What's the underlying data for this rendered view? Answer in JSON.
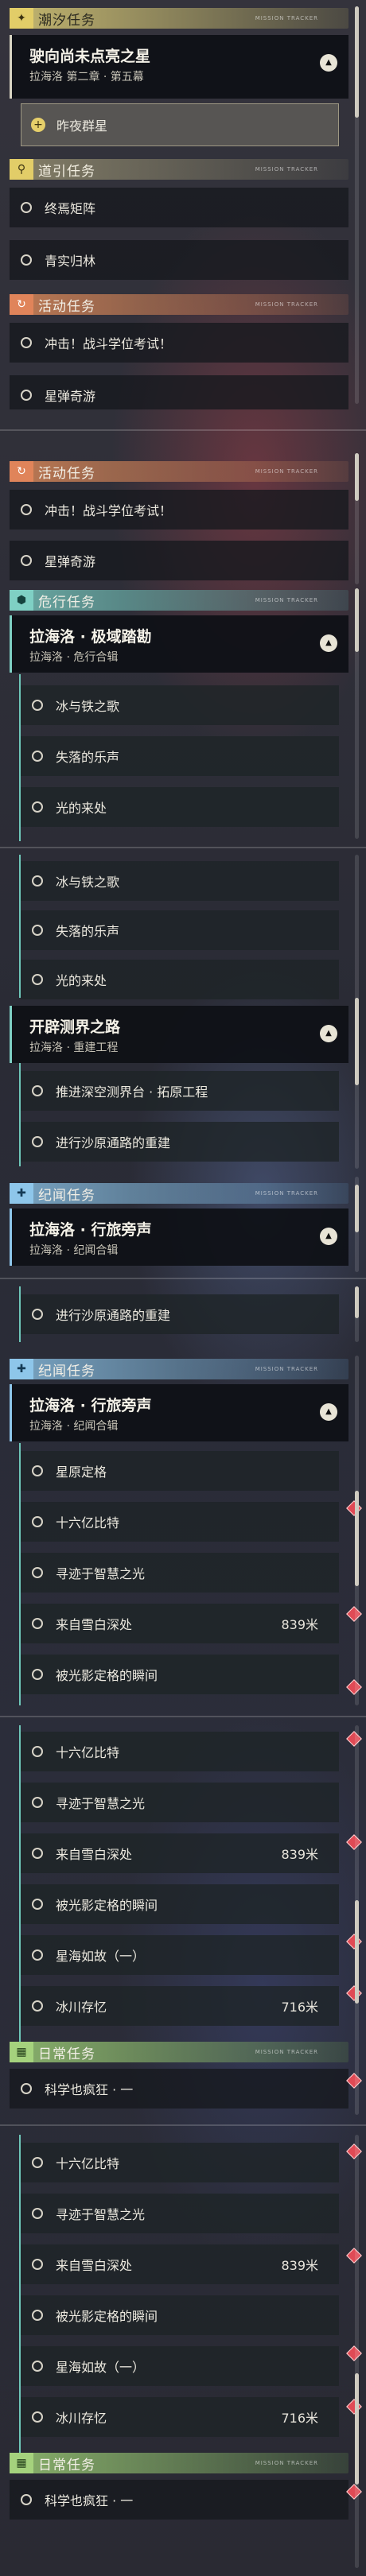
{
  "headers": {
    "chaoxi": "潮汐任务",
    "daoyin": "道引任务",
    "huodong": "活动任务",
    "weixing": "危行任务",
    "jiwen": "纪闻任务",
    "richang": "日常任务"
  },
  "header_tag": "MISSION TRACKER",
  "cards": {
    "lunar": {
      "title": "驶向尚未点亮之星",
      "subtitle": "拉海洛 第二章 · 第五幕"
    },
    "extreme": {
      "title": "拉海洛 · 极域踏勘",
      "subtitle": "拉海洛 · 危行合辑"
    },
    "kaipi": {
      "title": "开辟测界之路",
      "subtitle": "拉海洛 · 重建工程"
    },
    "xinglv": {
      "title": "拉海洛 · 行旅旁声",
      "subtitle": "拉海洛 · 纪闻合辑"
    }
  },
  "items": {
    "zuoye": "昨夜群星",
    "zhongyan": "终焉矩阵",
    "qingshi": "青实归林",
    "chongji": "冲击！战斗学位考试！",
    "xingdan": "星弹奇游",
    "bingtie": "冰与铁之歌",
    "shiluo": "失落的乐声",
    "guang": "光的来处",
    "tuijin": "推进深空测界台 · 拓原工程",
    "jinxing": "进行沙原通路的重建",
    "xingyuan": "星原定格",
    "shiliu": "十六亿比特",
    "xunji": "寻迹于智慧之光",
    "laizi": "来自雪白深处",
    "beiguang": "被光影定格的瞬间",
    "xinghai": "星海如故（一）",
    "binghe": "冰川存忆",
    "kexue": "科学也疯狂 · 一"
  },
  "distances": {
    "laizi": "839米",
    "binghe": "716米"
  },
  "colors": {
    "chaoxi": "#e2cd68",
    "huodong": "#e0845a",
    "weixing": "#7fd0c4",
    "jiwen": "#8ec6ea",
    "richang": "#a5d27d",
    "marker": "#e04a55"
  },
  "icons": {
    "chaoxi": "sparkle-icon",
    "daoyin": "map-pin-icon",
    "huodong": "refresh-icon",
    "weixing": "hexagon-icon",
    "jiwen": "plus-icon",
    "richang": "calendar-icon"
  }
}
